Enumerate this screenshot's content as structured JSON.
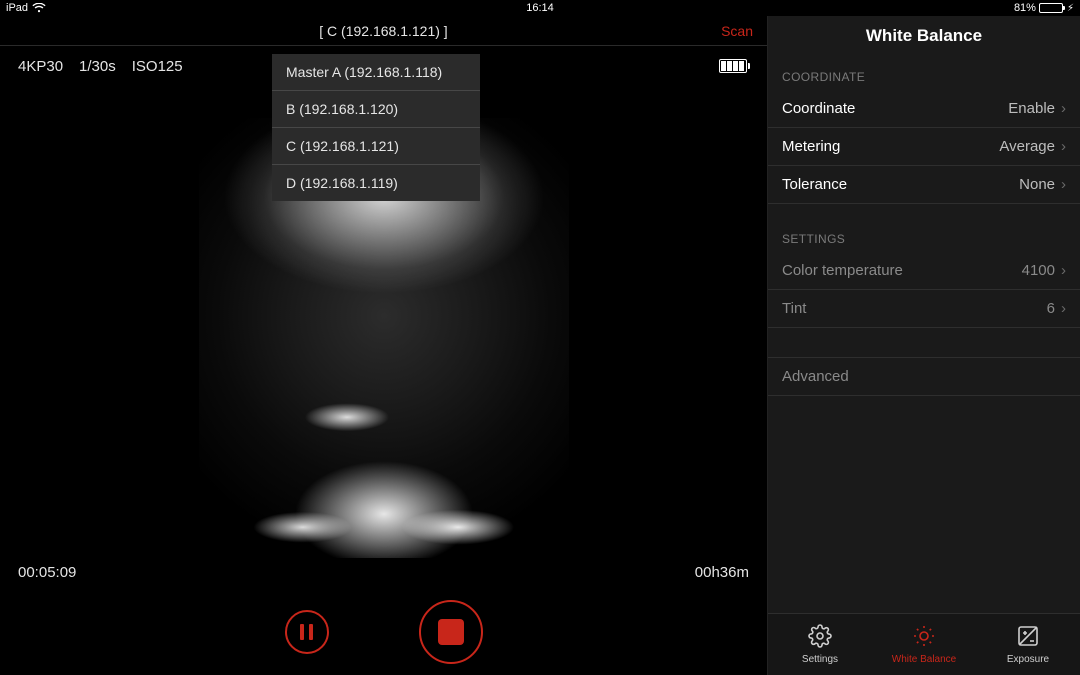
{
  "status": {
    "device": "iPad",
    "time": "16:14",
    "battery_pct": "81%",
    "battery_fill_pct": 81
  },
  "camera": {
    "selected_label": "[ C (192.168.1.121) ]",
    "scan_label": "Scan",
    "dropdown": [
      "Master A (192.168.1.118)",
      "B (192.168.1.120)",
      "C (192.168.1.121)",
      "D (192.168.1.119)"
    ],
    "resolution": "4KP30",
    "shutter": "1/30s",
    "iso": "ISO125",
    "elapsed": "00:05:09",
    "remaining": "00h36m"
  },
  "panel": {
    "title": "White Balance",
    "sections": {
      "coordinate_label": "COORDINATE",
      "settings_label": "SETTINGS"
    },
    "rows": {
      "coordinate": {
        "label": "Coordinate",
        "value": "Enable"
      },
      "metering": {
        "label": "Metering",
        "value": "Average"
      },
      "tolerance": {
        "label": "Tolerance",
        "value": "None"
      },
      "color_temp": {
        "label": "Color temperature",
        "value": "4100"
      },
      "tint": {
        "label": "Tint",
        "value": "6"
      },
      "advanced": {
        "label": "Advanced",
        "value": ""
      }
    }
  },
  "tabs": {
    "settings": "Settings",
    "white_balance": "White Balance",
    "exposure": "Exposure"
  }
}
